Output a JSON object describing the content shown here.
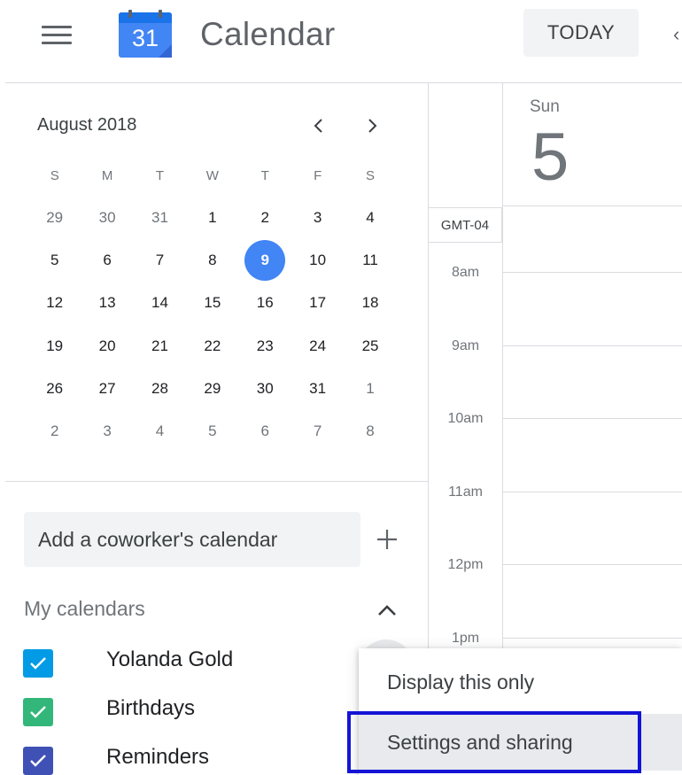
{
  "header": {
    "logo_number": "31",
    "app_title": "Calendar",
    "today_label": "TODAY",
    "prev_glyph": "‹"
  },
  "colors": {
    "accent_blue": "#4285f4",
    "logo_blue": "#4285f4",
    "logo_top": "#1a73e8",
    "yolanda": "#039be5",
    "birthdays": "#33b679",
    "reminders": "#3f51b5",
    "highlight_border": "#1414d6"
  },
  "mini_calendar": {
    "month_label": "August 2018",
    "weekday_headers": [
      "S",
      "M",
      "T",
      "W",
      "T",
      "F",
      "S"
    ],
    "selected_day": "9",
    "weeks": [
      [
        {
          "d": "29",
          "o": true
        },
        {
          "d": "30",
          "o": true
        },
        {
          "d": "31",
          "o": true
        },
        {
          "d": "1"
        },
        {
          "d": "2"
        },
        {
          "d": "3"
        },
        {
          "d": "4"
        }
      ],
      [
        {
          "d": "5"
        },
        {
          "d": "6"
        },
        {
          "d": "7"
        },
        {
          "d": "8"
        },
        {
          "d": "9",
          "sel": true
        },
        {
          "d": "10"
        },
        {
          "d": "11"
        }
      ],
      [
        {
          "d": "12"
        },
        {
          "d": "13"
        },
        {
          "d": "14"
        },
        {
          "d": "15"
        },
        {
          "d": "16"
        },
        {
          "d": "17"
        },
        {
          "d": "18"
        }
      ],
      [
        {
          "d": "19"
        },
        {
          "d": "20"
        },
        {
          "d": "21"
        },
        {
          "d": "22"
        },
        {
          "d": "23"
        },
        {
          "d": "24"
        },
        {
          "d": "25"
        }
      ],
      [
        {
          "d": "26"
        },
        {
          "d": "27"
        },
        {
          "d": "28"
        },
        {
          "d": "29"
        },
        {
          "d": "30"
        },
        {
          "d": "31"
        },
        {
          "d": "1",
          "o": true
        }
      ],
      [
        {
          "d": "2",
          "o": true
        },
        {
          "d": "3",
          "o": true
        },
        {
          "d": "4",
          "o": true
        },
        {
          "d": "5",
          "o": true
        },
        {
          "d": "6",
          "o": true
        },
        {
          "d": "7",
          "o": true
        },
        {
          "d": "8",
          "o": true
        }
      ]
    ]
  },
  "sidebar": {
    "coworker_placeholder": "Add a coworker's calendar",
    "my_calendars_label": "My calendars",
    "calendars": [
      {
        "name": "Yolanda Gold",
        "color": "#039be5"
      },
      {
        "name": "Birthdays",
        "color": "#33b679"
      },
      {
        "name": "Reminders",
        "color": "#3f51b5"
      }
    ]
  },
  "day_view": {
    "day_name": "Sun",
    "day_number": "5",
    "timezone": "GMT-04",
    "hours": [
      "8am",
      "9am",
      "10am",
      "11am",
      "12pm",
      "1pm"
    ]
  },
  "context_menu": {
    "items": [
      "Display this only",
      "Settings and sharing"
    ]
  }
}
